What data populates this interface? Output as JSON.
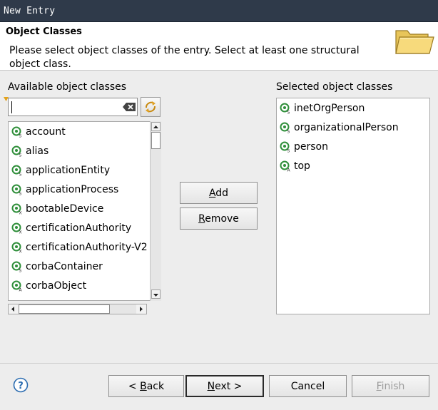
{
  "window": {
    "title": "New Entry"
  },
  "header": {
    "title": "Object Classes",
    "description": "Please select object classes of the entry. Select at least one structural object class."
  },
  "available": {
    "label": "Available object classes",
    "filter_value": "",
    "items": [
      {
        "label": "account"
      },
      {
        "label": "alias"
      },
      {
        "label": "applicationEntity"
      },
      {
        "label": "applicationProcess"
      },
      {
        "label": "bootableDevice"
      },
      {
        "label": "certificationAuthority"
      },
      {
        "label": "certificationAuthority-V2"
      },
      {
        "label": "corbaContainer"
      },
      {
        "label": "corbaObject"
      }
    ]
  },
  "selected": {
    "label": "Selected object classes",
    "items": [
      {
        "label": "inetOrgPerson"
      },
      {
        "label": "organizationalPerson"
      },
      {
        "label": "person"
      },
      {
        "label": "top"
      }
    ]
  },
  "actions": {
    "add": {
      "mnemonic": "A",
      "rest": "dd"
    },
    "remove": {
      "mnemonic": "R",
      "rest": "emove"
    }
  },
  "footer": {
    "back": {
      "prefix": "< ",
      "mnemonic": "B",
      "rest": "ack"
    },
    "next": {
      "mnemonic": "N",
      "rest": "ext >"
    },
    "cancel": {
      "label": "Cancel"
    },
    "finish": {
      "mnemonic": "F",
      "rest": "inish"
    }
  },
  "colors": {
    "titlebar": "#2f3a4a",
    "icon_green": "#2f8f3a",
    "folder_yellow": "#f4d36b",
    "disabled_text": "#9d9d9d"
  },
  "icons": {
    "object_class": "object-class-icon",
    "folder": "folder-icon",
    "help": "help-icon",
    "clear": "clear-filter-icon",
    "refresh": "refresh-icon"
  }
}
